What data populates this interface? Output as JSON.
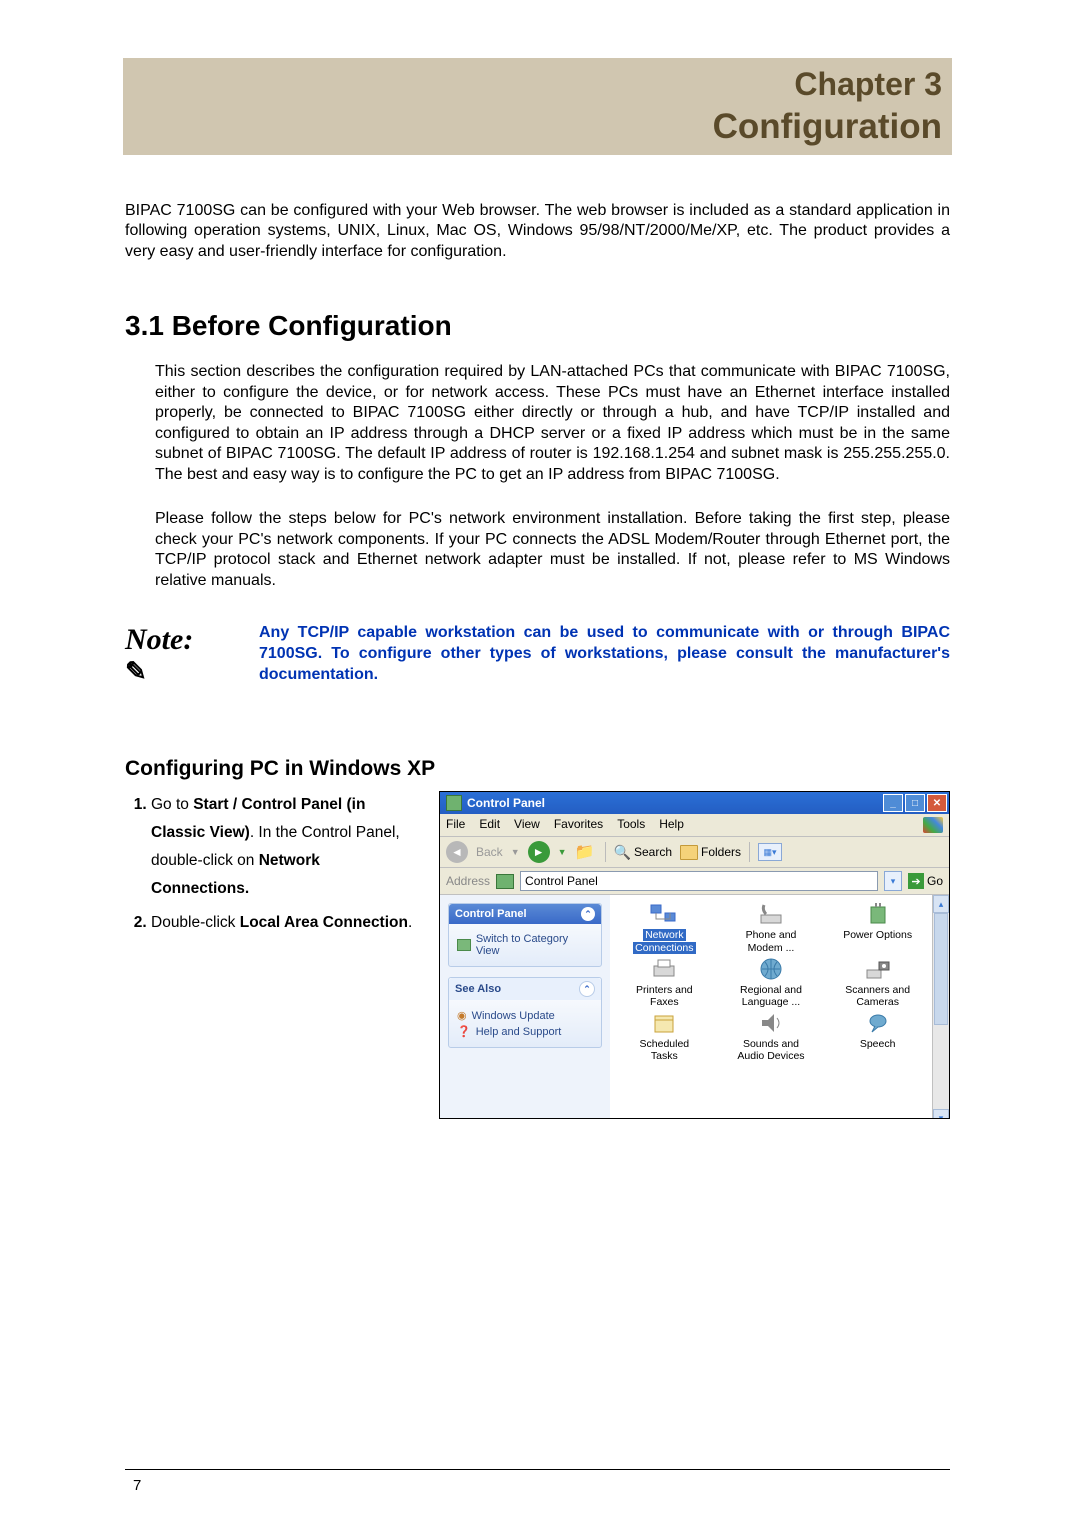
{
  "chapter": "Chapter 3",
  "title": "Configuration",
  "intro": "BIPAC 7100SG can be configured with your Web browser. The web browser is included as a standard application in following operation systems, UNIX, Linux, Mac OS, Windows 95/98/NT/2000/Me/XP, etc. The product provides a very easy and user-friendly interface for configuration.",
  "section_num_title": "3.1 Before Configuration",
  "section_p1": "This section describes the configuration required by LAN-attached PCs that communicate with BIPAC 7100SG, either to configure the device, or for network access. These PCs must have an Ethernet interface installed properly, be connected to BIPAC 7100SG either directly or through a hub, and have TCP/IP installed and configured to obtain an IP address through a DHCP server or a fixed IP address which must be in the same subnet of BIPAC 7100SG. The default IP address of router is 192.168.1.254 and subnet mask is 255.255.255.0. The best and easy way is to configure the PC to get an IP address from BIPAC 7100SG.",
  "section_p2": "Please follow the steps below for PC's network environment installation. Before taking the first step, please check your PC's network components. If your PC connects the ADSL Modem/Router through Ethernet port, the TCP/IP protocol stack and Ethernet network adapter must be installed. If not, please refer to MS Windows relative manuals.",
  "note_label": "Note:",
  "note_text": "Any TCP/IP capable workstation can be used to communicate with or through BIPAC 7100SG. To configure other types of workstations, please consult the manufacturer's documentation.",
  "sub_heading": "Configuring PC in Windows XP",
  "steps": {
    "s1_a": "Go to ",
    "s1_b": "Start / Control Panel (in Classic View)",
    "s1_c": ". In the Control Panel, double-click on ",
    "s1_d": "Network Connections.",
    "s2_a": "Double-click ",
    "s2_b": "Local Area Connection",
    "s2_c": "."
  },
  "win": {
    "title": "Control Panel",
    "menu": [
      "File",
      "Edit",
      "View",
      "Favorites",
      "Tools",
      "Help"
    ],
    "back": "Back",
    "search": "Search",
    "folders": "Folders",
    "address_label": "Address",
    "address_value": "Control Panel",
    "go": "Go",
    "cp_header": "Control Panel",
    "switch_view": "Switch to Category View",
    "see_also": "See Also",
    "see_items": [
      "Windows Update",
      "Help and Support"
    ],
    "icons": [
      {
        "l1": "Network",
        "l2": "Connections",
        "sel": true
      },
      {
        "l1": "Phone and",
        "l2": "Modem ..."
      },
      {
        "l1": "Power Options",
        "l2": ""
      },
      {
        "l1": "Printers and",
        "l2": "Faxes"
      },
      {
        "l1": "Regional and",
        "l2": "Language ..."
      },
      {
        "l1": "Scanners and",
        "l2": "Cameras"
      },
      {
        "l1": "Scheduled",
        "l2": "Tasks"
      },
      {
        "l1": "Sounds and",
        "l2": "Audio Devices"
      },
      {
        "l1": "Speech",
        "l2": ""
      }
    ]
  },
  "page_number": "7"
}
